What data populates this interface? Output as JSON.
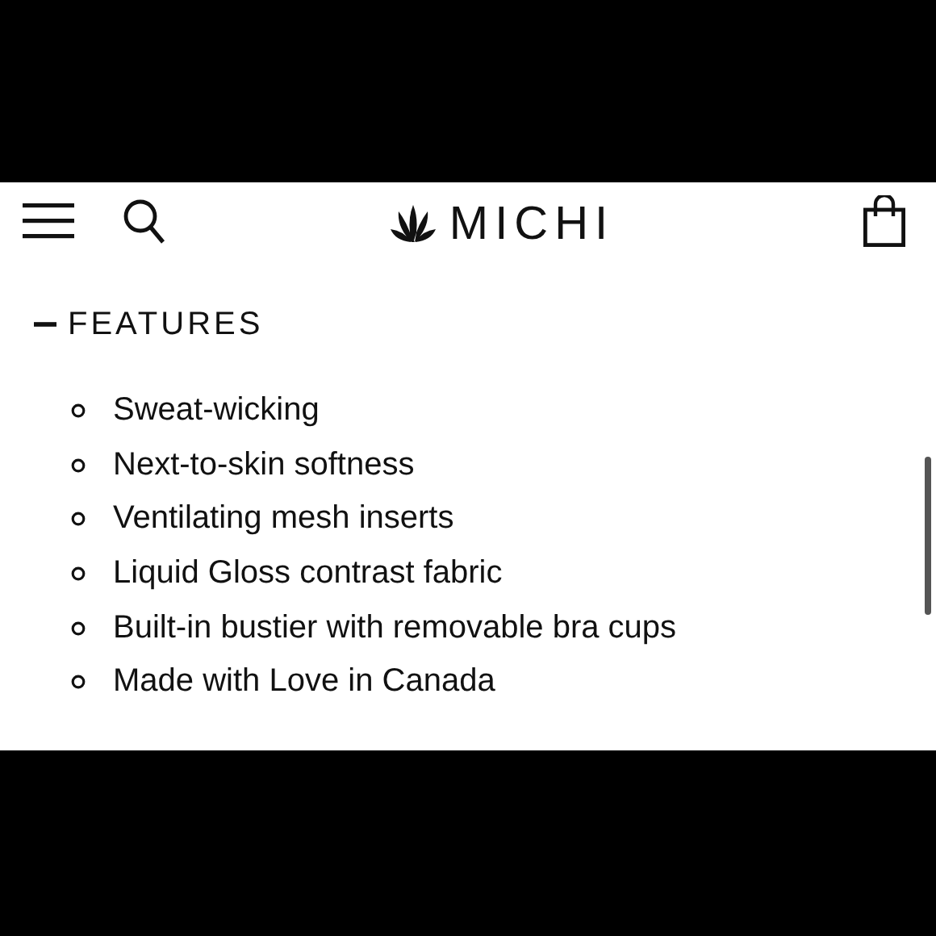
{
  "header": {
    "logo": "MICHI"
  },
  "section": {
    "title": "FEATURES",
    "expanded": true,
    "items": [
      "Sweat-wicking",
      "Next-to-skin softness",
      "Ventilating mesh inserts",
      "Liquid Gloss contrast fabric",
      "Built-in bustier with removable bra cups",
      "Made with Love in Canada"
    ]
  }
}
